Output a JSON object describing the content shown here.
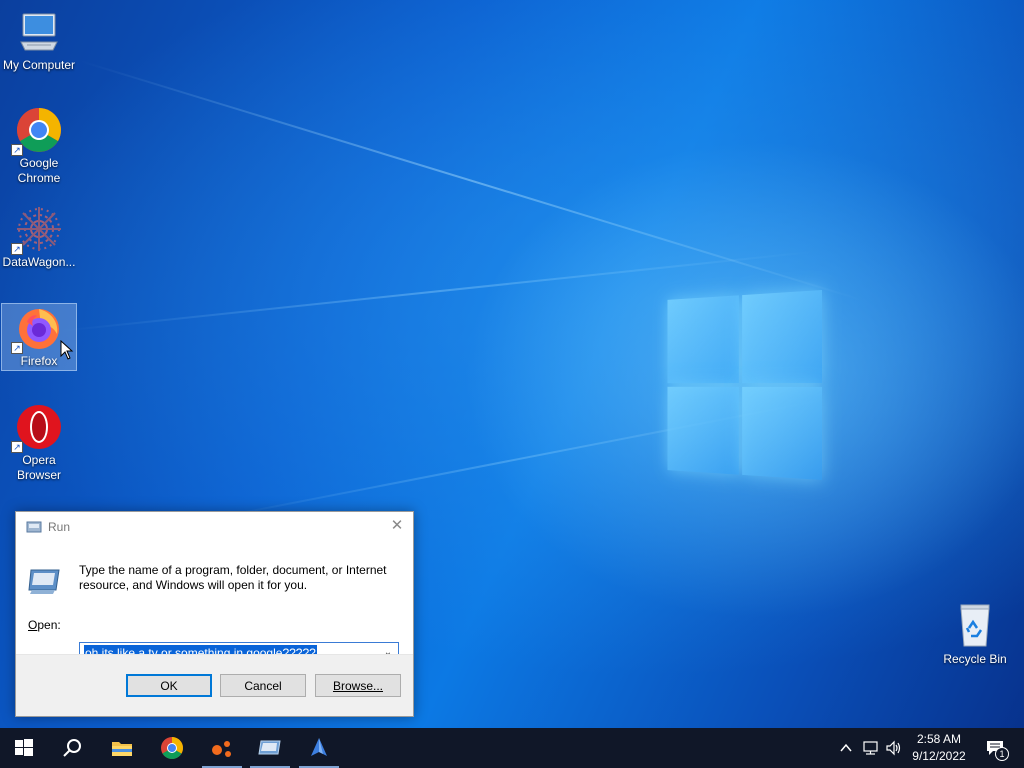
{
  "desktop": {
    "icons": [
      {
        "label": "My Computer",
        "icon": "computer-icon"
      },
      {
        "label": "Google Chrome",
        "icon": "chrome-icon",
        "shortcut": true
      },
      {
        "label": "DataWagon...",
        "icon": "datawagon-icon",
        "shortcut": true
      },
      {
        "label": "Firefox",
        "icon": "firefox-icon",
        "shortcut": true,
        "selected": true
      },
      {
        "label": "Opera Browser",
        "icon": "opera-icon",
        "shortcut": true
      },
      {
        "label": "Recycle Bin",
        "icon": "recycle-bin-icon"
      }
    ]
  },
  "run_dialog": {
    "title": "Run",
    "description": "Type the name of a program, folder, document, or Internet resource, and Windows will open it for you.",
    "open_label": "Open:",
    "open_label_accel": "O",
    "open_label_rest": "pen:",
    "input_value": "oh its like a tv or something in google?????",
    "buttons": {
      "ok": "OK",
      "cancel": "Cancel",
      "browse": "Browse..."
    }
  },
  "taskbar": {
    "items": [
      {
        "name": "start",
        "icon": "windows-start-icon"
      },
      {
        "name": "search",
        "icon": "search-icon"
      },
      {
        "name": "file-explorer",
        "icon": "folder-icon",
        "active": true
      },
      {
        "name": "chrome",
        "icon": "chrome-icon"
      },
      {
        "name": "app-orange",
        "icon": "orange-dots-icon",
        "active": true
      },
      {
        "name": "run",
        "icon": "run-icon",
        "active": true
      },
      {
        "name": "app-blue",
        "icon": "blue-app-icon",
        "active": true
      }
    ],
    "clock": {
      "time": "2:58 AM",
      "date": "9/12/2022"
    },
    "notifications_count": "1"
  },
  "colors": {
    "taskbar": "#101728",
    "accent": "#0078d7",
    "selection": "#0a64d8"
  }
}
